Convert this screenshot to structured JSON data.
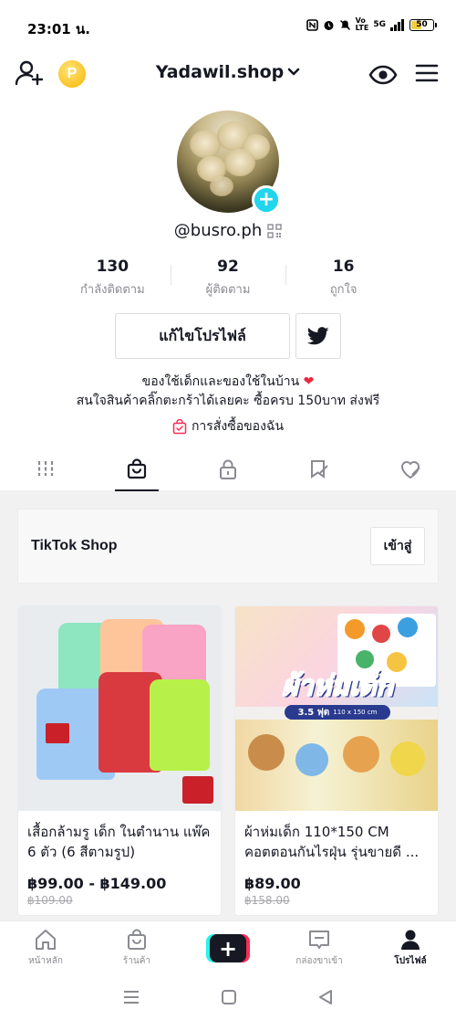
{
  "status_bar": {
    "time": "23:01 น.",
    "network": "5G",
    "battery": "50"
  },
  "top_nav": {
    "account_name": "Yadawil.shop",
    "coin_symbol": "P"
  },
  "profile": {
    "username": "@busro.ph",
    "stats": [
      {
        "value": "130",
        "label": "กำลังติดตาม"
      },
      {
        "value": "92",
        "label": "ผู้ติดตาม"
      },
      {
        "value": "16",
        "label": "ถูกใจ"
      }
    ],
    "edit_button": "แก้ไขโปรไฟล์",
    "bio_line1": "ของใช้เด็กและของใช้ในบ้าน",
    "bio_heart": "❤",
    "bio_line2": "สนใจสินค้าคลิ๊กตะกร้าได้เลยคะ ซื้อครบ 150บาท ส่งฟรี",
    "orders_link": "การสั่งซื้อของฉัน"
  },
  "tabs": [
    {
      "icon": "grid-icon",
      "active": false
    },
    {
      "icon": "shop-bag-icon",
      "active": true
    },
    {
      "icon": "lock-icon",
      "active": false
    },
    {
      "icon": "bookmark-icon",
      "active": false
    },
    {
      "icon": "liked-icon",
      "active": false
    }
  ],
  "shop": {
    "title": "TikTok Shop",
    "enter_label": "เข้าสู่"
  },
  "products": [
    {
      "name": "เสื้อกล้ามรู เด็ก ในตำนาน แพ๊ค 6 ตัว (6 สีตามรูป)",
      "price": "฿99.00 - ฿149.00",
      "old_price": "฿109.00"
    },
    {
      "name": "ผ้าห่มเด็ก 110*150 CM คอตตอนกันไรฝุ่น รุ่นขายดี ...",
      "price": "฿89.00",
      "old_price": "฿158.00",
      "banner_title": "ผ้าห่มเด็ก",
      "banner_sub": "3.5 ฟุต",
      "banner_size": "110 x 150 cm"
    }
  ],
  "bottom_nav": [
    {
      "label": "หน้าหลัก",
      "icon": "home-icon"
    },
    {
      "label": "ร้านค้า",
      "icon": "shop-icon"
    },
    {
      "label": "+",
      "icon": "create-icon"
    },
    {
      "label": "กล่องขาเข้า",
      "icon": "inbox-icon"
    },
    {
      "label": "โปรไฟล์",
      "icon": "profile-icon"
    }
  ],
  "colors": {
    "accent_cyan": "#20d5ec",
    "tiktok_pink": "#fe2c55",
    "tiktok_teal": "#25f4ee",
    "text_primary": "#161823",
    "text_secondary": "#8a8b91"
  }
}
